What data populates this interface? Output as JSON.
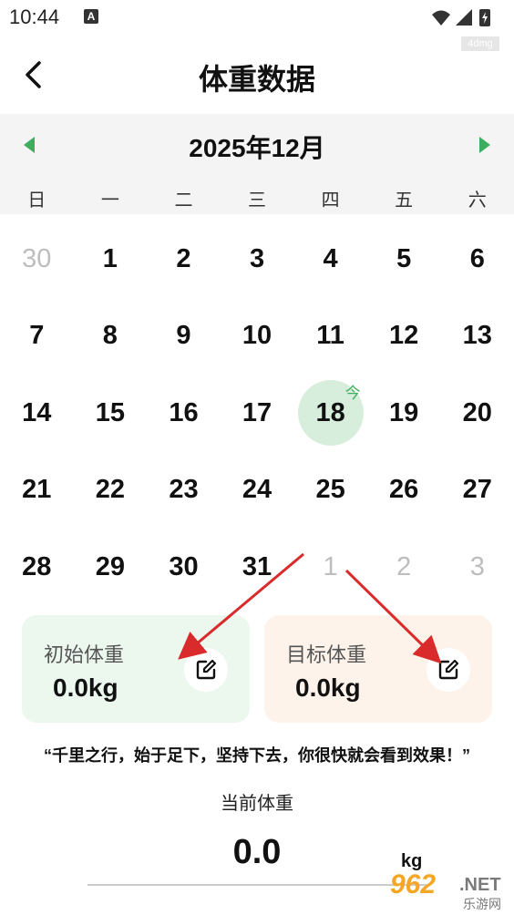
{
  "status_bar": {
    "time": "10:44",
    "notification_icon": "A",
    "watermark_tag": "4dmg"
  },
  "nav": {
    "back_icon": "chevron-left-icon",
    "title": "体重数据"
  },
  "calendar": {
    "month_label": "2025年12月",
    "accent_color": "#3dae5d",
    "weekdays": [
      "日",
      "一",
      "二",
      "三",
      "四",
      "五",
      "六"
    ],
    "weeks": [
      [
        {
          "d": "30",
          "muted": true
        },
        {
          "d": "1"
        },
        {
          "d": "2"
        },
        {
          "d": "3"
        },
        {
          "d": "4"
        },
        {
          "d": "5"
        },
        {
          "d": "6"
        }
      ],
      [
        {
          "d": "7"
        },
        {
          "d": "8"
        },
        {
          "d": "9"
        },
        {
          "d": "10"
        },
        {
          "d": "11"
        },
        {
          "d": "12"
        },
        {
          "d": "13"
        }
      ],
      [
        {
          "d": "14"
        },
        {
          "d": "15"
        },
        {
          "d": "16"
        },
        {
          "d": "17"
        },
        {
          "d": "18",
          "today": true
        },
        {
          "d": "19"
        },
        {
          "d": "20"
        }
      ],
      [
        {
          "d": "21"
        },
        {
          "d": "22"
        },
        {
          "d": "23"
        },
        {
          "d": "24"
        },
        {
          "d": "25"
        },
        {
          "d": "26"
        },
        {
          "d": "27"
        }
      ],
      [
        {
          "d": "28"
        },
        {
          "d": "29"
        },
        {
          "d": "30"
        },
        {
          "d": "31"
        },
        {
          "d": "1",
          "muted": true
        },
        {
          "d": "2",
          "muted": true
        },
        {
          "d": "3",
          "muted": true
        }
      ]
    ],
    "today_mark": "今"
  },
  "cards": {
    "initial": {
      "label": "初始体重",
      "value": "0.0kg"
    },
    "goal": {
      "label": "目标体重",
      "value": "0.0kg"
    }
  },
  "quote": "“千里之行，始于足下，坚持下去，你很快就会看到效果！”",
  "current": {
    "label": "当前体重",
    "value": "0.0",
    "unit": "kg"
  },
  "watermark": {
    "num": "962",
    "net": ".NET",
    "sub": "乐游网"
  },
  "colors": {
    "initial_card": "#ecf7ee",
    "goal_card": "#fdf3ea",
    "today_circle": "#d8eedd",
    "annotation_arrow": "#d92b2b"
  }
}
